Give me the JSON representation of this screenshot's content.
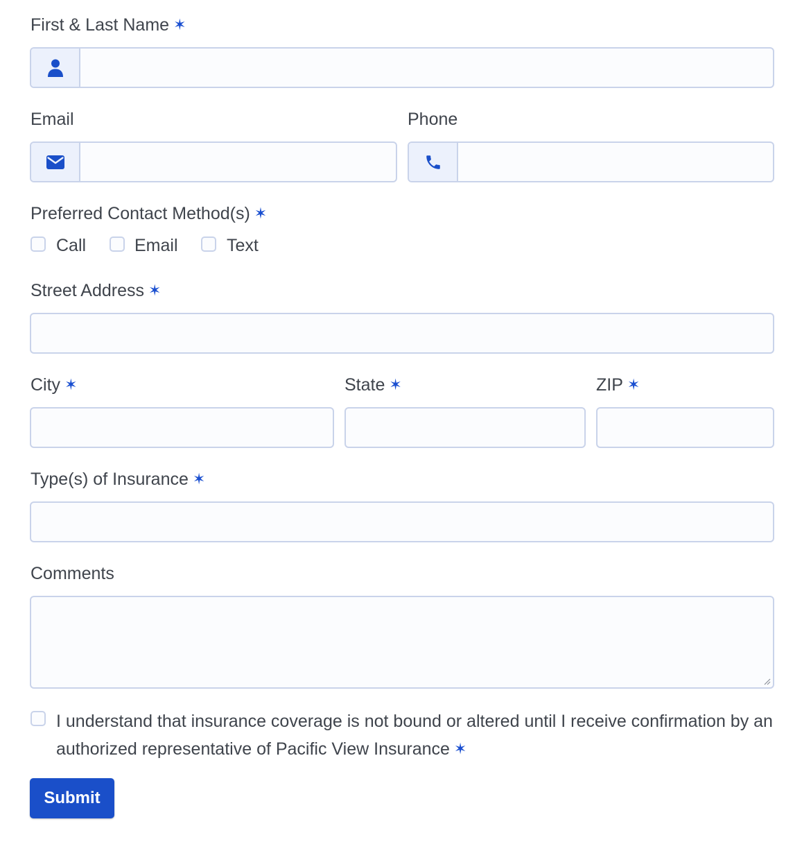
{
  "form": {
    "name": {
      "label": "First & Last Name",
      "required_mark": "✶",
      "value": ""
    },
    "email": {
      "label": "Email",
      "value": ""
    },
    "phone": {
      "label": "Phone",
      "value": ""
    },
    "contact_method": {
      "label": "Preferred Contact Method(s)",
      "required_mark": "✶",
      "options": [
        {
          "label": "Call",
          "checked": false
        },
        {
          "label": "Email",
          "checked": false
        },
        {
          "label": "Text",
          "checked": false
        }
      ]
    },
    "street": {
      "label": "Street Address",
      "required_mark": "✶",
      "value": ""
    },
    "city": {
      "label": "City",
      "required_mark": "✶",
      "value": ""
    },
    "state": {
      "label": "State",
      "required_mark": "✶",
      "value": ""
    },
    "zip": {
      "label": "ZIP",
      "required_mark": "✶",
      "value": ""
    },
    "insurance_types": {
      "label": "Type(s) of Insurance",
      "required_mark": "✶",
      "value": ""
    },
    "comments": {
      "label": "Comments",
      "value": ""
    },
    "consent": {
      "text": "I understand that insurance coverage is not bound or altered until I receive confirmation by an authorized representative of Pacific View Insurance",
      "required_mark": "✶",
      "checked": false
    },
    "submit_label": "Submit"
  },
  "icons": {
    "name": "user-icon",
    "email": "envelope-icon",
    "phone": "phone-icon"
  },
  "colors": {
    "accent": "#1a4fc9",
    "border": "#c9d3ea",
    "addon_bg": "#ecf1fc"
  }
}
